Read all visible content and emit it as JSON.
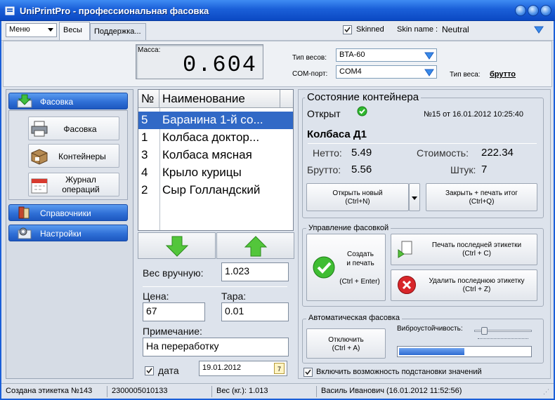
{
  "window": {
    "title": "UniPrintPro - профессиональная фасовка"
  },
  "toolbar": {
    "menu_label": "Меню",
    "tabs": [
      "Весы",
      "Поддержка..."
    ],
    "skinned_label": "Skinned",
    "skinned_checked": true,
    "skin_name_label": "Skin name :",
    "skin_name_value": "Neutral"
  },
  "scale": {
    "mass_label": "Масса:",
    "mass_value": "0.604",
    "scale_type_label": "Тип весов:",
    "scale_type_value": "BTA-60",
    "com_port_label": "COM-порт:",
    "com_port_value": "COM4",
    "weight_type_label": "Тип веса:",
    "weight_type_value": "брутто"
  },
  "sidebar": {
    "groups": [
      {
        "label": "Фасовка",
        "icon": "download-icon"
      },
      {
        "label": "Справочники",
        "icon": "books-icon"
      },
      {
        "label": "Настройки",
        "icon": "settings-icon"
      }
    ],
    "subitems": [
      {
        "label": "Фасовка",
        "icon": "printer-icon"
      },
      {
        "label": "Контейнеры",
        "icon": "box-icon"
      },
      {
        "label1": "Журнал",
        "label2": "операций",
        "icon": "calendar-icon"
      }
    ]
  },
  "table": {
    "headers": [
      "№",
      "Наименование"
    ],
    "rows": [
      {
        "no": "5",
        "name": "Баранина 1-й со...",
        "selected": true
      },
      {
        "no": "1",
        "name": "Колбаса доктор..."
      },
      {
        "no": "3",
        "name": "Колбаса мясная"
      },
      {
        "no": "4",
        "name": "Крыло курицы"
      },
      {
        "no": "2",
        "name": "Сыр Голландский"
      }
    ]
  },
  "form": {
    "manual_weight_label": "Вес вручную:",
    "manual_weight_value": "1.023",
    "price_label": "Цена:",
    "price_value": "67",
    "tare_label": "Тара:",
    "tare_value": "0.01",
    "note_label": "Примечание:",
    "note_value": "На переработку",
    "date_label": "дата",
    "date_checked": true,
    "date_value": "19.01.2012",
    "date_icon_text": "7"
  },
  "container": {
    "title": "Состояние контейнера",
    "state": "Открыт",
    "number_info": "№15 от 16.01.2012 10:25:40",
    "product": "Колбаса Д1",
    "net_label": "Нетто:",
    "net_value": "5.49",
    "cost_label": "Стоимость:",
    "cost_value": "222.34",
    "gross_label": "Брутто:",
    "gross_value": "5.56",
    "count_label": "Штук:",
    "count_value": "7",
    "open_new_label": "Открыть новый",
    "open_new_shortcut": "(Ctrl+N)",
    "close_print_label": "Закрыть + печать итог",
    "close_print_shortcut": "(Ctrl+Q)"
  },
  "packing": {
    "title": "Управление фасовкой",
    "create_print_line1": "Создать",
    "create_print_line2": "и печать",
    "create_print_shortcut": "(Ctrl + Enter)",
    "print_last_label": "Печать последней этикетки",
    "print_last_shortcut": "(Ctrl + C)",
    "delete_last_label": "Удалить последнюю этикетку",
    "delete_last_shortcut": "(Ctrl + Z)"
  },
  "auto": {
    "title": "Автоматическая фасовка",
    "disable_label": "Отключить",
    "disable_shortcut": "(Ctrl + A)",
    "vibration_label": "Виброустойчивость:",
    "vibration_level": 0.12,
    "progress_fraction": 0.5,
    "enable_substitution_label": "Включить возможность подстановки значений",
    "enable_substitution_checked": true
  },
  "statusbar": {
    "label_created": "Создана этикетка №143",
    "barcode": "2300005010133",
    "weight": "Вес (кг.): 1.013",
    "user": "Василь Иванович (16.01.2012 11:52:56)"
  },
  "colors": {
    "accent": "#2f6fd6",
    "selection": "#3169c6",
    "ok_green": "#2fb82f",
    "delete_red": "#d8262a"
  }
}
